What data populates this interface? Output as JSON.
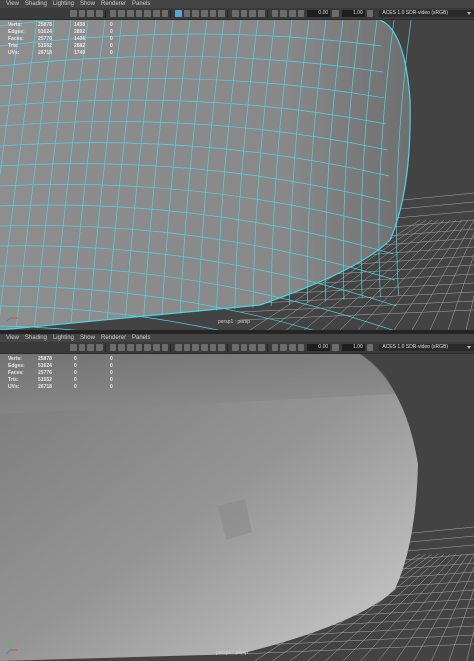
{
  "menu": [
    "View",
    "Shading",
    "Lighting",
    "Show",
    "Renderer",
    "Panels"
  ],
  "toolbar": {
    "field1": "0.00",
    "field2": "1.00",
    "colorspace": "ACES 1.0 SDR-video (sRGB)"
  },
  "hud_top": {
    "rows": [
      {
        "label": "Verts:",
        "v1": "25878",
        "v2": "1458",
        "v3": "0"
      },
      {
        "label": "Edges:",
        "v1": "51624",
        "v2": "2892",
        "v3": "0"
      },
      {
        "label": "Faces:",
        "v1": "25776",
        "v2": "1436",
        "v3": "0"
      },
      {
        "label": "Tris:",
        "v1": "51552",
        "v2": "2882",
        "v3": "0"
      },
      {
        "label": "UVs:",
        "v1": "26718",
        "v2": "1740",
        "v3": "0"
      }
    ]
  },
  "hud_bottom": {
    "rows": [
      {
        "label": "Verts:",
        "v1": "25878",
        "v2": "0",
        "v3": "0"
      },
      {
        "label": "Edges:",
        "v1": "51624",
        "v2": "0",
        "v3": "0"
      },
      {
        "label": "Faces:",
        "v1": "25776",
        "v2": "0",
        "v3": "0"
      },
      {
        "label": "Tris:",
        "v1": "51552",
        "v2": "0",
        "v3": "0"
      },
      {
        "label": "UVs:",
        "v1": "26718",
        "v2": "0",
        "v3": "0"
      }
    ]
  },
  "camera_label": "persp1 : persp",
  "colors": {
    "wire": "#4fd3e6",
    "surface": "#8a8a8a",
    "grid": "#a9a9a9",
    "bg": "#434343"
  }
}
